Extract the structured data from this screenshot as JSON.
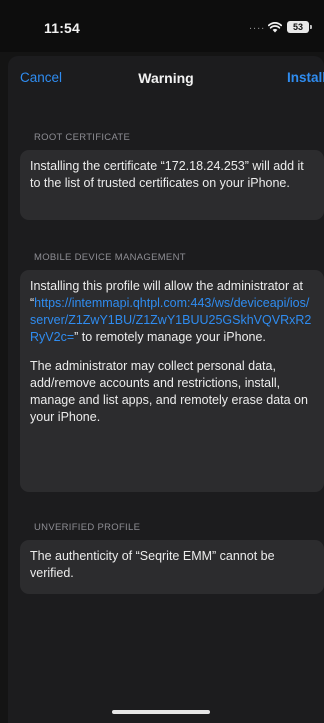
{
  "status": {
    "time": "11:54",
    "signal": "....",
    "battery": "53"
  },
  "nav": {
    "cancel": "Cancel",
    "title": "Warning",
    "install": "Install"
  },
  "root_certificate": {
    "header": "ROOT CERTIFICATE",
    "text": "Installing the certificate “172.18.24.253” will add it to the list of trusted certificates on your iPhone."
  },
  "mdm": {
    "header": "MOBILE DEVICE MANAGEMENT",
    "text_before_link": "Installing this profile will allow the administrator at “",
    "link": "https://intemmapi.qhtpl.com:443/ws/deviceapi/ios/server/Z1ZwY1BU/Z1ZwY1BUU25GSkhVQVRxR2RyV2c=",
    "text_after_link": "” to remotely manage your iPhone.",
    "paragraph2": "The administrator may collect personal data, add/remove accounts and restrictions, install, manage and list apps, and remotely erase data on your iPhone."
  },
  "unverified": {
    "header": "UNVERIFIED PROFILE",
    "text": "The authenticity of “Seqrite EMM” cannot be verified."
  },
  "icons": {
    "wifi": "wifi-icon",
    "battery": "battery-icon"
  },
  "colors": {
    "accent": "#2f8cf0",
    "card": "#2c2c2e",
    "sheet": "#1c1c1e"
  }
}
